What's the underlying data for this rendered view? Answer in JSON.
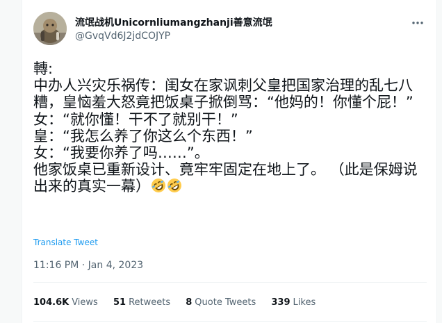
{
  "author": {
    "display_name": "流氓战机Unicornliumangzhanji善意流氓",
    "handle": "@GvqVd6J2jdCOJYP"
  },
  "tweet": {
    "lines": [
      "轉:",
      "中办人兴灾乐祸传：闺女在家讽刺父皇把国家治理的乱七八糟，皇恼羞大怒竟把饭桌子掀倒骂：“他妈的！你懂个屁！”",
      "女：“就你懂！干不了就别干！”",
      "皇：“我怎么养了你这么个东西！”",
      "女：“我要你养了吗……”。",
      "他家饭桌已重新设计、竟牢牢固定在地上了。 （此是保姆说出来的真实一幕）"
    ],
    "emojis": [
      "rolling-on-floor-laughing",
      "rolling-on-floor-laughing"
    ]
  },
  "translate_label": "Translate Tweet",
  "timestamp": "11:16 PM · Jan 4, 2023",
  "stats": {
    "views": {
      "count": "104.6K",
      "label": "Views"
    },
    "retweets": {
      "count": "51",
      "label": "Retweets"
    },
    "quote_tweets": {
      "count": "8",
      "label": "Quote Tweets"
    },
    "likes": {
      "count": "339",
      "label": "Likes"
    }
  },
  "colors": {
    "text": "#0f1419",
    "secondary": "#536471",
    "link": "#1d9bf0",
    "border": "#eff3f4"
  }
}
